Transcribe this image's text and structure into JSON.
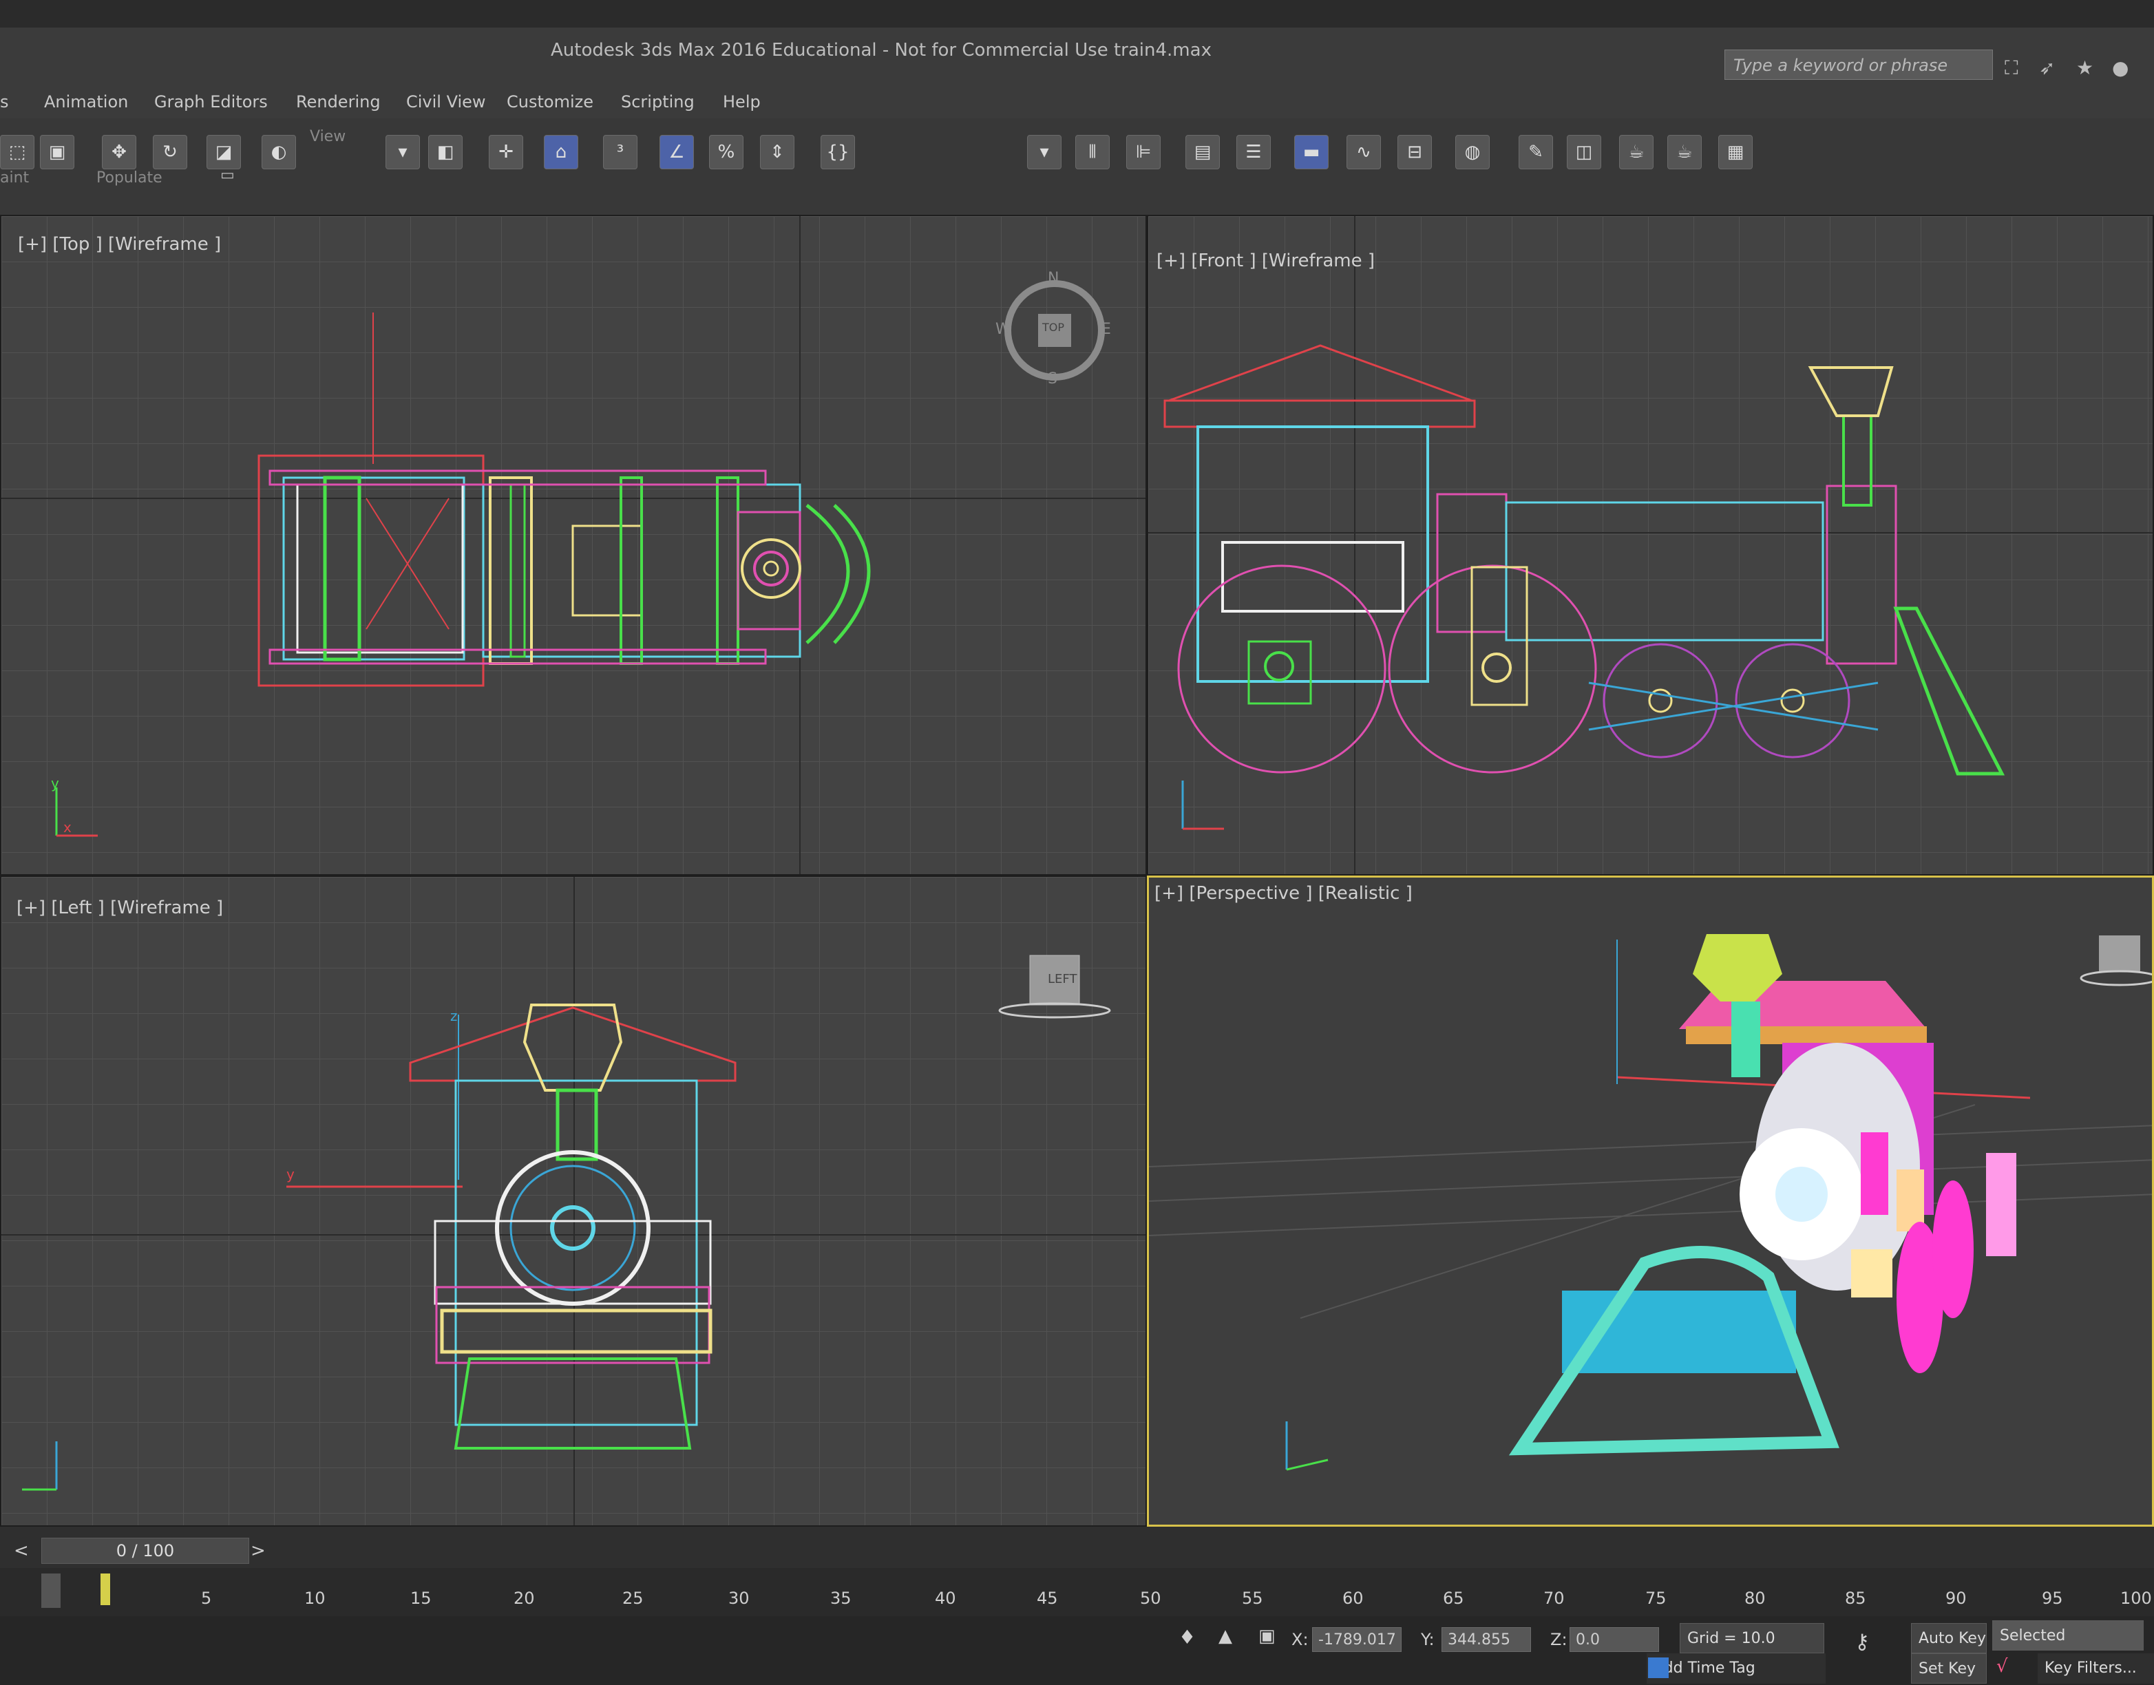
{
  "title": "Autodesk 3ds Max 2016 Educational - Not for Commercial Use    train4.max",
  "search": {
    "placeholder": "Type a keyword or phrase"
  },
  "menu": [
    "s",
    "Animation",
    "Graph Editors",
    "Rendering",
    "Civil View",
    "Customize",
    "Scripting",
    "Help"
  ],
  "toolbar": {
    "view_label": "View",
    "populate_label": "Populate",
    "paint_label": "aint"
  },
  "viewports": {
    "top": "[+] [Top ] [Wireframe ]",
    "front": "[+] [Front ] [Wireframe ]",
    "left": "[+] [Left ] [Wireframe ]",
    "perspective": "[+] [Perspective ] [Realistic ]"
  },
  "viewcube": {
    "north": "N",
    "south": "S",
    "east": "E",
    "west": "W",
    "top_face": "TOP",
    "left_face": "LEFT"
  },
  "axes": {
    "x": "x",
    "y": "y",
    "z": "z"
  },
  "timeline": {
    "frame": "0 / 100",
    "prev": "<",
    "next": ">"
  },
  "ticks": [
    "5",
    "10",
    "15",
    "20",
    "25",
    "30",
    "35",
    "40",
    "45",
    "50",
    "55",
    "60",
    "65",
    "70",
    "75",
    "80",
    "85",
    "90",
    "95",
    "100"
  ],
  "status": {
    "x_label": "X:",
    "x_value": "-1789.017",
    "y_label": "Y:",
    "y_value": "344.855",
    "z_label": "Z:",
    "z_value": "0.0",
    "grid": "Grid = 10.0",
    "auto_key": "Auto Key",
    "selected": "Selected",
    "set_key": "Set Key",
    "key_filters": "Key Filters...",
    "add_time_tag": "Add Time Tag"
  },
  "colors": {
    "accent_yellow": "#d8c24a",
    "active_tool": "#4d63a8",
    "wire_red": "#e0424a",
    "wire_cyan": "#5fd6e8",
    "wire_green": "#49e04a",
    "wire_pink": "#e050b0"
  }
}
